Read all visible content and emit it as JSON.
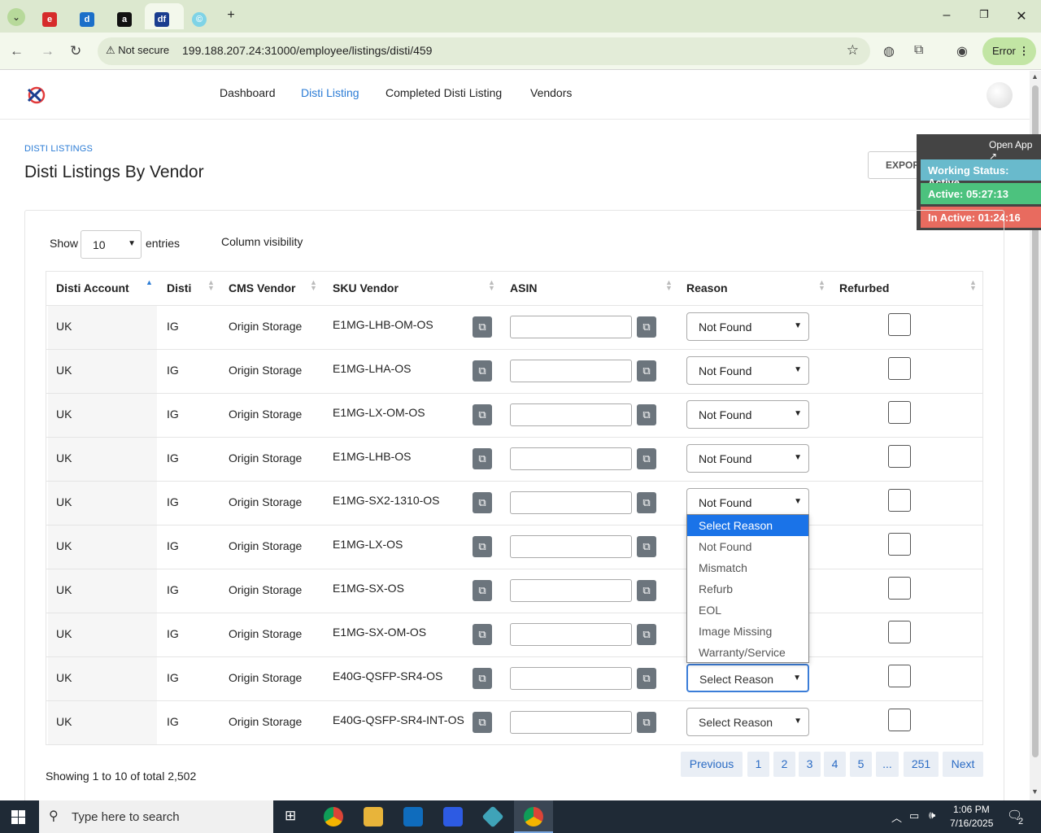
{
  "browser": {
    "address": "199.188.207.24:31000/employee/listings/disti/459",
    "security_label": "Not secure",
    "profile_status": "Error"
  },
  "app": {
    "nav": [
      "Dashboard",
      "Disti Listing",
      "Completed Disti Listing",
      "Vendors"
    ],
    "active_nav": "Disti Listing"
  },
  "page": {
    "breadcrumb": "DISTI LISTINGS",
    "title": "Disti Listings By Vendor",
    "export_label": "EXPORT DISTI LISTING"
  },
  "status_widget": {
    "open_app": "Open App ↗",
    "working": "Working Status: Active",
    "active": "Active: 05:27:13",
    "inactive": "In Active: 01:24:16"
  },
  "controls": {
    "show_label": "Show",
    "page_size": "10",
    "entries_label": "entries",
    "column_visibility": "Column visibility"
  },
  "table": {
    "headers": [
      "Disti Account",
      "Disti",
      "CMS Vendor",
      "SKU Vendor",
      "ASIN",
      "Reason",
      "Refurbed"
    ],
    "rows": [
      {
        "account": "UK",
        "disti": "IG",
        "vendor": "Origin Storage",
        "sku": "E1MG-LHB-OM-OS",
        "reason": "Not Found"
      },
      {
        "account": "UK",
        "disti": "IG",
        "vendor": "Origin Storage",
        "sku": "E1MG-LHA-OS",
        "reason": "Not Found"
      },
      {
        "account": "UK",
        "disti": "IG",
        "vendor": "Origin Storage",
        "sku": "E1MG-LX-OM-OS",
        "reason": "Not Found"
      },
      {
        "account": "UK",
        "disti": "IG",
        "vendor": "Origin Storage",
        "sku": "E1MG-LHB-OS",
        "reason": "Not Found"
      },
      {
        "account": "UK",
        "disti": "IG",
        "vendor": "Origin Storage",
        "sku": "E1MG-SX2-1310-OS",
        "reason": "Not Found"
      },
      {
        "account": "UK",
        "disti": "IG",
        "vendor": "Origin Storage",
        "sku": "E1MG-LX-OS",
        "reason": ""
      },
      {
        "account": "UK",
        "disti": "IG",
        "vendor": "Origin Storage",
        "sku": "E1MG-SX-OS",
        "reason": ""
      },
      {
        "account": "UK",
        "disti": "IG",
        "vendor": "Origin Storage",
        "sku": "E1MG-SX-OM-OS",
        "reason": ""
      },
      {
        "account": "UK",
        "disti": "IG",
        "vendor": "Origin Storage",
        "sku": "E40G-QSFP-SR4-OS",
        "reason": "Select Reason"
      },
      {
        "account": "UK",
        "disti": "IG",
        "vendor": "Origin Storage",
        "sku": "E40G-QSFP-SR4-INT-OS",
        "reason": "Select Reason"
      }
    ]
  },
  "reason_options": [
    "Select Reason",
    "Not Found",
    "Mismatch",
    "Refurb",
    "EOL",
    "Image Missing",
    "Warranty/Service"
  ],
  "reason_highlighted": "Select Reason",
  "pagination": {
    "summary": "Showing 1 to 10 of total 2,502",
    "previous": "Previous",
    "pages": [
      "1",
      "2",
      "3",
      "4",
      "5",
      "...",
      "251"
    ],
    "next": "Next"
  },
  "taskbar": {
    "search_placeholder": "Type here to search",
    "time": "1:06 PM",
    "date": "7/16/2025",
    "notifications": "2"
  }
}
